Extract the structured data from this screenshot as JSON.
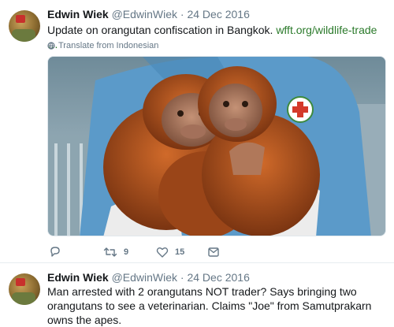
{
  "tweets": [
    {
      "name": "Edwin Wiek",
      "handle": "@EdwinWiek",
      "separator": "·",
      "date": "24 Dec 2016",
      "text": "Update on orangutan confiscation in Bangkok.",
      "link": "wfft.org/wildlife-trade …",
      "translate": "Translate from Indonesian",
      "actions": {
        "reply_count": "",
        "retweet_count": "9",
        "like_count": "15"
      }
    },
    {
      "name": "Edwin Wiek",
      "handle": "@EdwinWiek",
      "separator": "·",
      "date": "24 Dec 2016",
      "text": "Man arrested with 2 orangutans NOT trader? Says bringing two orangutans to see a veterinarian. Claims \"Joe\" from Samutprakarn owns the apes."
    }
  ],
  "icons": {
    "reply": "reply-icon",
    "retweet": "retweet-icon",
    "like": "heart-icon",
    "dm": "envelope-icon",
    "translate": "globe-icon"
  },
  "colors": {
    "link": "#2b7a2b",
    "secondary_text": "#657786",
    "primary_text": "#14171a",
    "divider": "#e6ecf0"
  }
}
